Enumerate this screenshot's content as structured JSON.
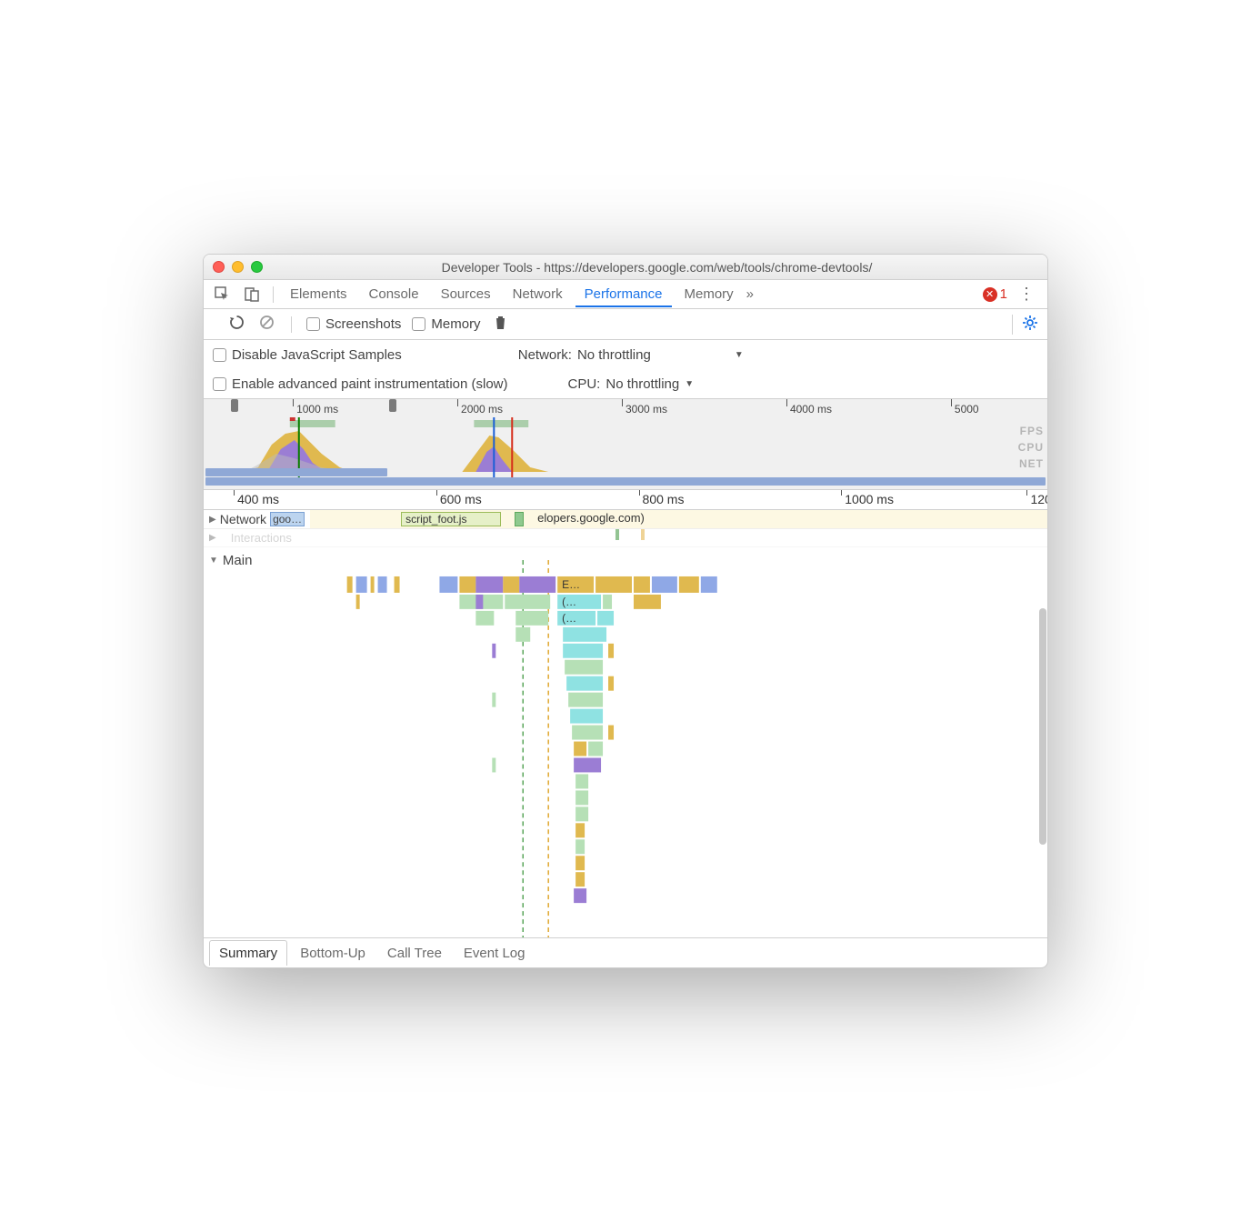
{
  "window_title": "Developer Tools - https://developers.google.com/web/tools/chrome-devtools/",
  "error_count": "1",
  "main_tabs": [
    "Elements",
    "Console",
    "Sources",
    "Network",
    "Performance",
    "Memory"
  ],
  "active_main_tab": "Performance",
  "toolbar": {
    "screenshots": "Screenshots",
    "memory": "Memory"
  },
  "settings": {
    "disable_js": "Disable JavaScript Samples",
    "enable_paint": "Enable advanced paint instrumentation (slow)",
    "network_label": "Network:",
    "cpu_label": "CPU:",
    "network_value": "No throttling",
    "cpu_value": "No throttling"
  },
  "overview_ticks": [
    {
      "label": "1000 ms",
      "pct": 11
    },
    {
      "label": "2000 ms",
      "pct": 30.5
    },
    {
      "label": "3000 ms",
      "pct": 50
    },
    {
      "label": "4000 ms",
      "pct": 69.5
    },
    {
      "label": "5000",
      "pct": 89
    }
  ],
  "overview_labels": [
    "FPS",
    "CPU",
    "NET"
  ],
  "ruler_ticks": [
    {
      "label": "400 ms",
      "pct": 4
    },
    {
      "label": "600 ms",
      "pct": 28
    },
    {
      "label": "800 ms",
      "pct": 52
    },
    {
      "label": "1000 ms",
      "pct": 76
    },
    {
      "label": "120",
      "pct": 98
    }
  ],
  "tracks": {
    "network": "Network",
    "network_item1": "goo…",
    "network_item2": "script_foot.js",
    "network_item3": "elopers.google.com)",
    "interactions": "Interactions",
    "main": "Main",
    "main_e": "E…",
    "main_p1": "(…",
    "main_p2": "(…"
  },
  "bottom_tabs": [
    "Summary",
    "Bottom-Up",
    "Call Tree",
    "Event Log"
  ],
  "active_bottom_tab": "Summary"
}
